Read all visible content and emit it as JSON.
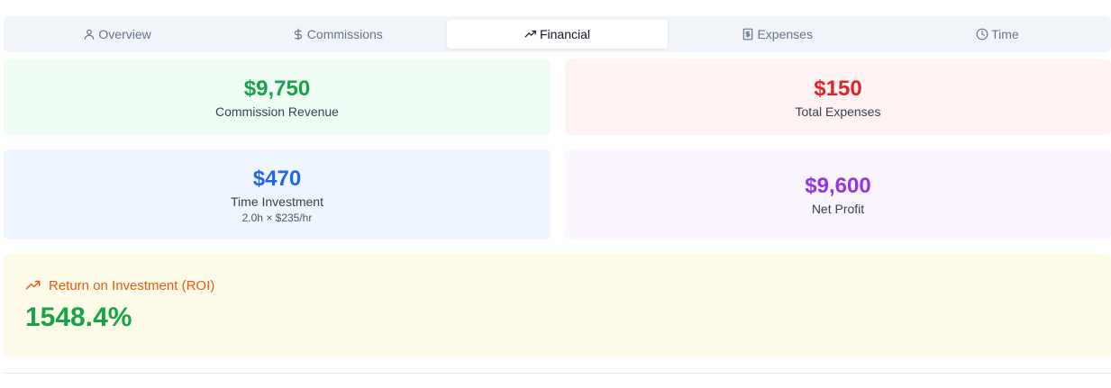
{
  "tabs": [
    {
      "label": "Overview",
      "icon": "user-icon",
      "active": false
    },
    {
      "label": "Commissions",
      "icon": "dollar-icon",
      "active": false
    },
    {
      "label": "Financial",
      "icon": "trending-up-icon",
      "active": true
    },
    {
      "label": "Expenses",
      "icon": "receipt-icon",
      "active": false
    },
    {
      "label": "Time",
      "icon": "clock-icon",
      "active": false
    }
  ],
  "cards": {
    "revenue": {
      "value": "$9,750",
      "label": "Commission Revenue",
      "color": "#16a34a"
    },
    "expenses": {
      "value": "$150",
      "label": "Total Expenses",
      "color": "#dc2626"
    },
    "time": {
      "value": "$470",
      "label": "Time Investment",
      "sub": "2.0h × $235/hr",
      "color": "#2563eb"
    },
    "profit": {
      "value": "$9,600",
      "label": "Net Profit",
      "color": "#9333ea"
    }
  },
  "roi": {
    "title": "Return on Investment (ROI)",
    "value": "1548.4%",
    "title_color": "#ea580c",
    "value_color": "#16a34a"
  }
}
